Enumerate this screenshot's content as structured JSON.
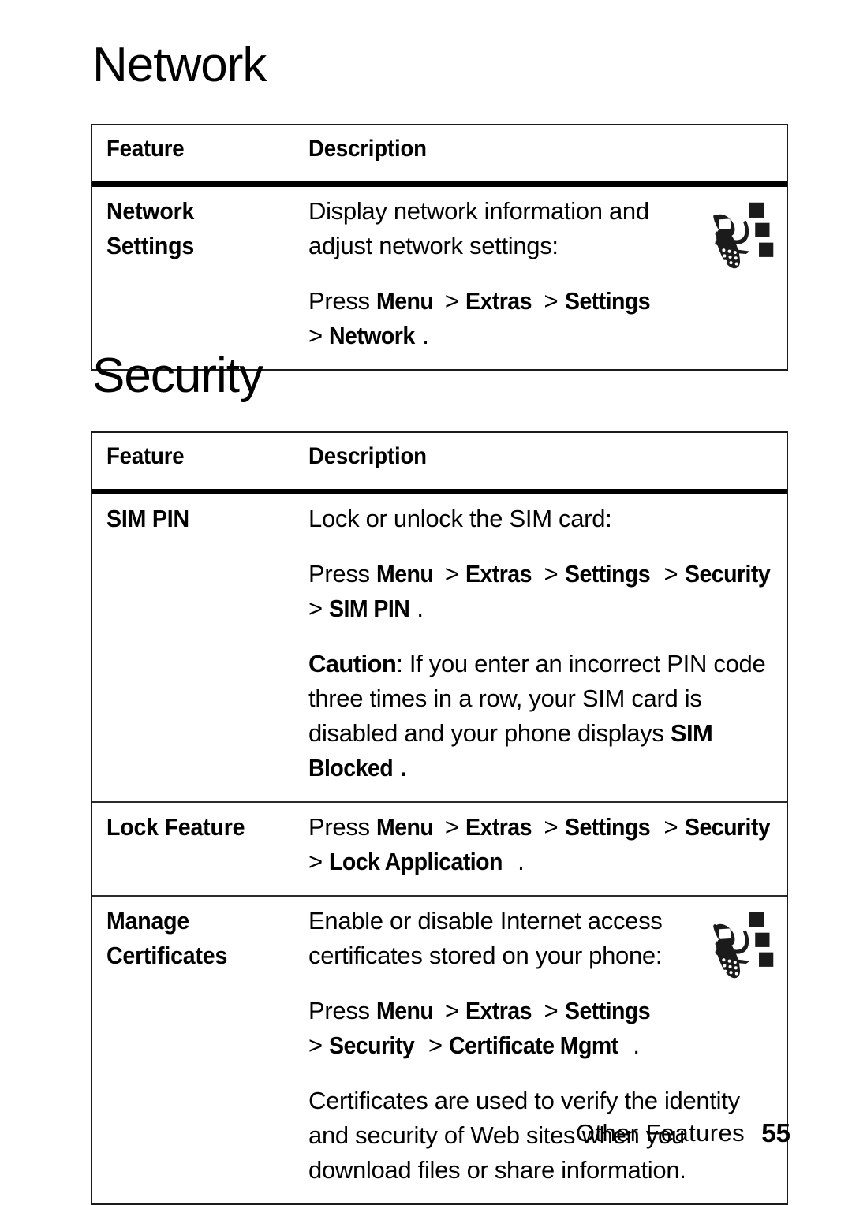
{
  "document": {
    "sections": [
      {
        "id": "network",
        "heading": "Network",
        "table": {
          "columns": {
            "feature": "Feature",
            "description": "Description"
          },
          "rows": [
            {
              "feature_lines": [
                "Network",
                "Settings"
              ],
              "has_icon": true,
              "icon": "flip-phone-network-icon",
              "paragraphs": [
                {
                  "type": "plain",
                  "lines": [
                    "Display network information and",
                    "adjust network settings:"
                  ]
                },
                {
                  "type": "menu-path",
                  "spaced": true,
                  "lines": [
                    [
                      {
                        "t": "Press ",
                        "b": false
                      },
                      {
                        "t": "Menu",
                        "b": true
                      },
                      {
                        "t": " > ",
                        "b": false
                      },
                      {
                        "t": "Extras",
                        "b": true
                      },
                      {
                        "t": " > ",
                        "b": false
                      },
                      {
                        "t": "Settings",
                        "b": true
                      }
                    ],
                    [
                      {
                        "t": "> ",
                        "b": false
                      },
                      {
                        "t": "Network",
                        "b": true
                      },
                      {
                        "t": ".",
                        "b": false
                      }
                    ]
                  ]
                }
              ]
            }
          ]
        }
      },
      {
        "id": "security",
        "heading": "Security",
        "table": {
          "columns": {
            "feature": "Feature",
            "description": "Description"
          },
          "rows": [
            {
              "feature_lines": [
                "SIM PIN"
              ],
              "has_icon": false,
              "paragraphs": [
                {
                  "type": "plain",
                  "lines": [
                    "Lock or unlock the SIM card:"
                  ]
                },
                {
                  "type": "menu-path",
                  "spaced": true,
                  "lines": [
                    [
                      {
                        "t": "Press ",
                        "b": false
                      },
                      {
                        "t": "Menu",
                        "b": true
                      },
                      {
                        "t": " > ",
                        "b": false
                      },
                      {
                        "t": "Extras",
                        "b": true
                      },
                      {
                        "t": " > ",
                        "b": false
                      },
                      {
                        "t": "Settings",
                        "b": true
                      },
                      {
                        "t": " > ",
                        "b": false
                      },
                      {
                        "t": "Security",
                        "b": true
                      }
                    ],
                    [
                      {
                        "t": "> ",
                        "b": false
                      },
                      {
                        "t": "SIM PIN",
                        "b": true
                      },
                      {
                        "t": ".",
                        "b": false
                      }
                    ]
                  ]
                },
                {
                  "type": "mixed",
                  "spaced": true,
                  "lines": [
                    [
                      {
                        "t": "Caution",
                        "b": true
                      },
                      {
                        "t": ": If you enter an incorrect PIN code",
                        "b": false
                      }
                    ],
                    [
                      {
                        "t": "three times in a row, your SIM card is",
                        "b": false
                      }
                    ],
                    [
                      {
                        "t": "disabled and your phone displays ",
                        "b": false
                      },
                      {
                        "t": "SIM",
                        "b": true
                      }
                    ],
                    [
                      {
                        "t": "Blocked",
                        "b": true
                      },
                      {
                        "t": ".",
                        "b": true
                      }
                    ]
                  ]
                }
              ]
            },
            {
              "feature_lines": [
                "Lock Feature"
              ],
              "has_icon": false,
              "paragraphs": [
                {
                  "type": "menu-path",
                  "spaced": false,
                  "lines": [
                    [
                      {
                        "t": "Press ",
                        "b": false
                      },
                      {
                        "t": "Menu",
                        "b": true
                      },
                      {
                        "t": " > ",
                        "b": false
                      },
                      {
                        "t": "Extras",
                        "b": true
                      },
                      {
                        "t": " > ",
                        "b": false
                      },
                      {
                        "t": "Settings",
                        "b": true
                      },
                      {
                        "t": " > ",
                        "b": false
                      },
                      {
                        "t": "Security",
                        "b": true
                      }
                    ],
                    [
                      {
                        "t": "> ",
                        "b": false
                      },
                      {
                        "t": "Lock Application",
                        "b": true
                      },
                      {
                        "t": ".",
                        "b": false
                      }
                    ]
                  ]
                }
              ]
            },
            {
              "feature_lines": [
                "Manage",
                "Certificates"
              ],
              "has_icon": true,
              "icon": "flip-phone-network-icon",
              "paragraphs": [
                {
                  "type": "plain",
                  "lines": [
                    "Enable or disable Internet access",
                    "certificates stored on your phone:"
                  ]
                },
                {
                  "type": "menu-path",
                  "spaced": true,
                  "lines": [
                    [
                      {
                        "t": "Press ",
                        "b": false
                      },
                      {
                        "t": "Menu",
                        "b": true
                      },
                      {
                        "t": " > ",
                        "b": false
                      },
                      {
                        "t": "Extras",
                        "b": true
                      },
                      {
                        "t": " > ",
                        "b": false
                      },
                      {
                        "t": "Settings",
                        "b": true
                      }
                    ],
                    [
                      {
                        "t": "> ",
                        "b": false
                      },
                      {
                        "t": "Security",
                        "b": true
                      },
                      {
                        "t": " > ",
                        "b": false
                      },
                      {
                        "t": "Certificate Mgmt",
                        "b": true
                      },
                      {
                        "t": ".",
                        "b": false
                      }
                    ]
                  ]
                },
                {
                  "type": "plain",
                  "spaced": true,
                  "lines": [
                    "Certificates are used to verify the identity",
                    "and security of Web sites when you",
                    "download files or share information."
                  ]
                }
              ]
            }
          ]
        }
      }
    ],
    "footer": {
      "label": "Other Features",
      "page_number": "55"
    },
    "colors": {
      "text": "#000000",
      "background": "#ffffff",
      "table_border": "#1b1b1b",
      "header_rule": "#000000"
    }
  }
}
